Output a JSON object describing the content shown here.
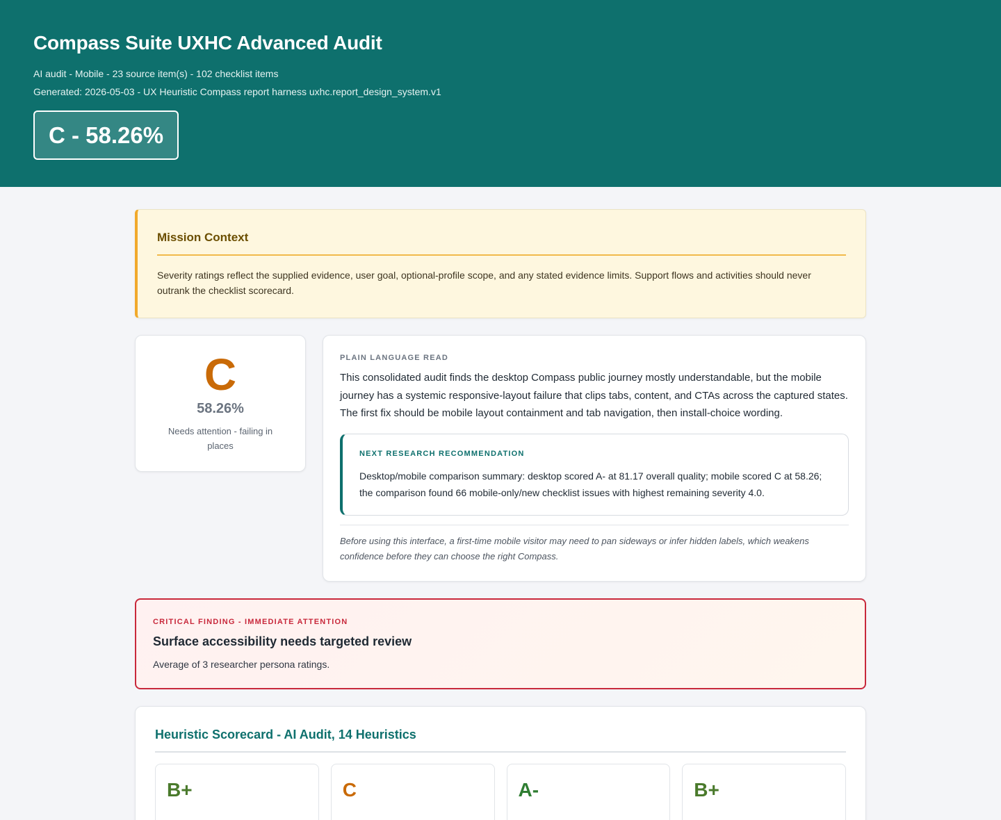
{
  "header": {
    "title": "Compass Suite UXHC Advanced Audit",
    "meta_line_1": "AI audit - Mobile - 23 source item(s) - 102 checklist items",
    "meta_line_2": "Generated: 2026-05-03 - UX Heuristic Compass report harness uxhc.report_design_system.v1",
    "grade_badge": "C - 58.26%"
  },
  "mission": {
    "title": "Mission Context",
    "body": "Severity ratings reflect the supplied evidence, user goal, optional-profile scope, and any stated evidence limits. Support flows and activities should never outrank the checklist scorecard."
  },
  "grade_card": {
    "letter": "C",
    "percent": "58.26%",
    "status": "Needs attention - failing in places"
  },
  "plain_language": {
    "eyebrow": "Plain Language Read",
    "body": "This consolidated audit finds the desktop Compass public journey mostly understandable, but the mobile journey has a systemic responsive-layout failure that clips tabs, content, and CTAs across the captured states. The first fix should be mobile layout containment and tab navigation, then install-choice wording.",
    "recommendation": {
      "eyebrow": "Next Research Recommendation",
      "body": "Desktop/mobile comparison summary: desktop scored A- at 81.17 overall quality; mobile scored C at 58.26; the comparison found 66 mobile-only/new checklist issues with highest remaining severity 4.0."
    },
    "note": "Before using this interface, a first-time mobile visitor may need to pan sideways or infer hidden labels, which weakens confidence before they can choose the right Compass."
  },
  "critical": {
    "eyebrow": "Critical Finding - Immediate Attention",
    "title": "Surface accessibility needs targeted review",
    "body": "Average of 3 researcher persona ratings."
  },
  "scorecard": {
    "title": "Heuristic Scorecard - AI Audit, 14 Heuristics",
    "tiles": [
      {
        "grade": "B+",
        "color": "#4a7a2c"
      },
      {
        "grade": "C",
        "color": "#c96a07"
      },
      {
        "grade": "A-",
        "color": "#2f7d32"
      },
      {
        "grade": "B+",
        "color": "#4a7a2c"
      }
    ]
  },
  "colors": {
    "brand": "#0e706d",
    "grade_c": "#c96a07",
    "critical": "#c8283b",
    "mission_accent": "#f1a92b"
  }
}
